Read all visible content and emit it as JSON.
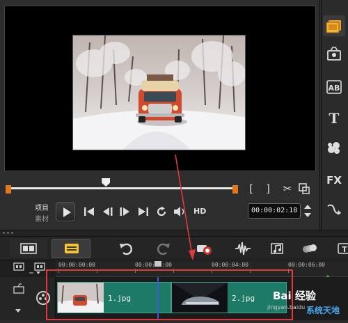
{
  "preview": {
    "mode_project": "项目",
    "mode_clip": "素材",
    "hd": "HD",
    "timecode": "00:00:02:18",
    "progress_fraction": 0.43
  },
  "timeline": {
    "ruler": [
      "00:00:00:00",
      "00:00:02:00",
      "00:00:04:00",
      "00:00:06:00"
    ],
    "clips": [
      {
        "label": "1.jpg"
      },
      {
        "label": "2.jpg"
      }
    ]
  },
  "watermark": {
    "brand": "Bai 经验",
    "url": "jingyan.baidu",
    "site": "系统天地"
  },
  "colors": {
    "accent_orange": "#e07a18",
    "clip_green": "#1c7a66",
    "annotation_red": "#e23a3a",
    "playhead_blue": "#3d5bd8"
  }
}
